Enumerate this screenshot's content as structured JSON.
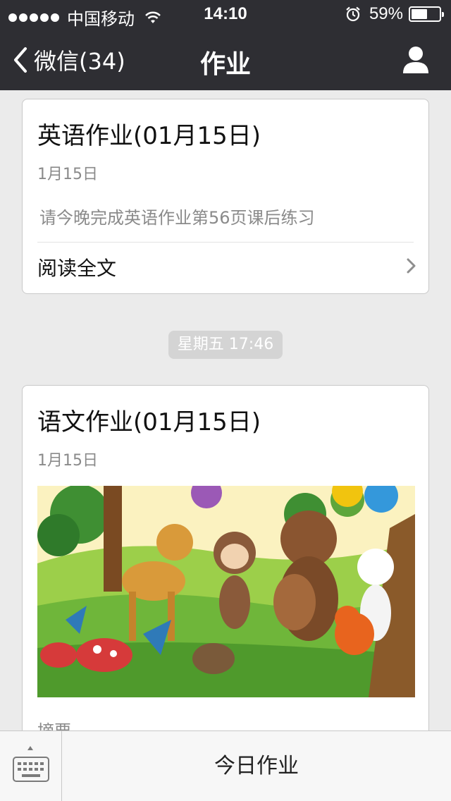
{
  "status_bar": {
    "carrier": "中国移动",
    "time": "14:10",
    "battery_percent": "59%",
    "battery_level": 0.59,
    "signal_dots": 5
  },
  "nav": {
    "back_label": "微信(34)",
    "title": "作业"
  },
  "messages": [
    {
      "title": "英语作业(01月15日)",
      "date": "1月15日",
      "description": "请今晚完成英语作业第56页课后练习",
      "link_label": "阅读全文"
    },
    {
      "timestamp": "星期五 17:46"
    },
    {
      "title": "语文作业(01月15日)",
      "date": "1月15日",
      "summary_partial": "摘要"
    }
  ],
  "bottom_bar": {
    "menu_label": "今日作业"
  },
  "colors": {
    "header_bg": "#2e2e33",
    "page_bg": "#ebebeb"
  }
}
